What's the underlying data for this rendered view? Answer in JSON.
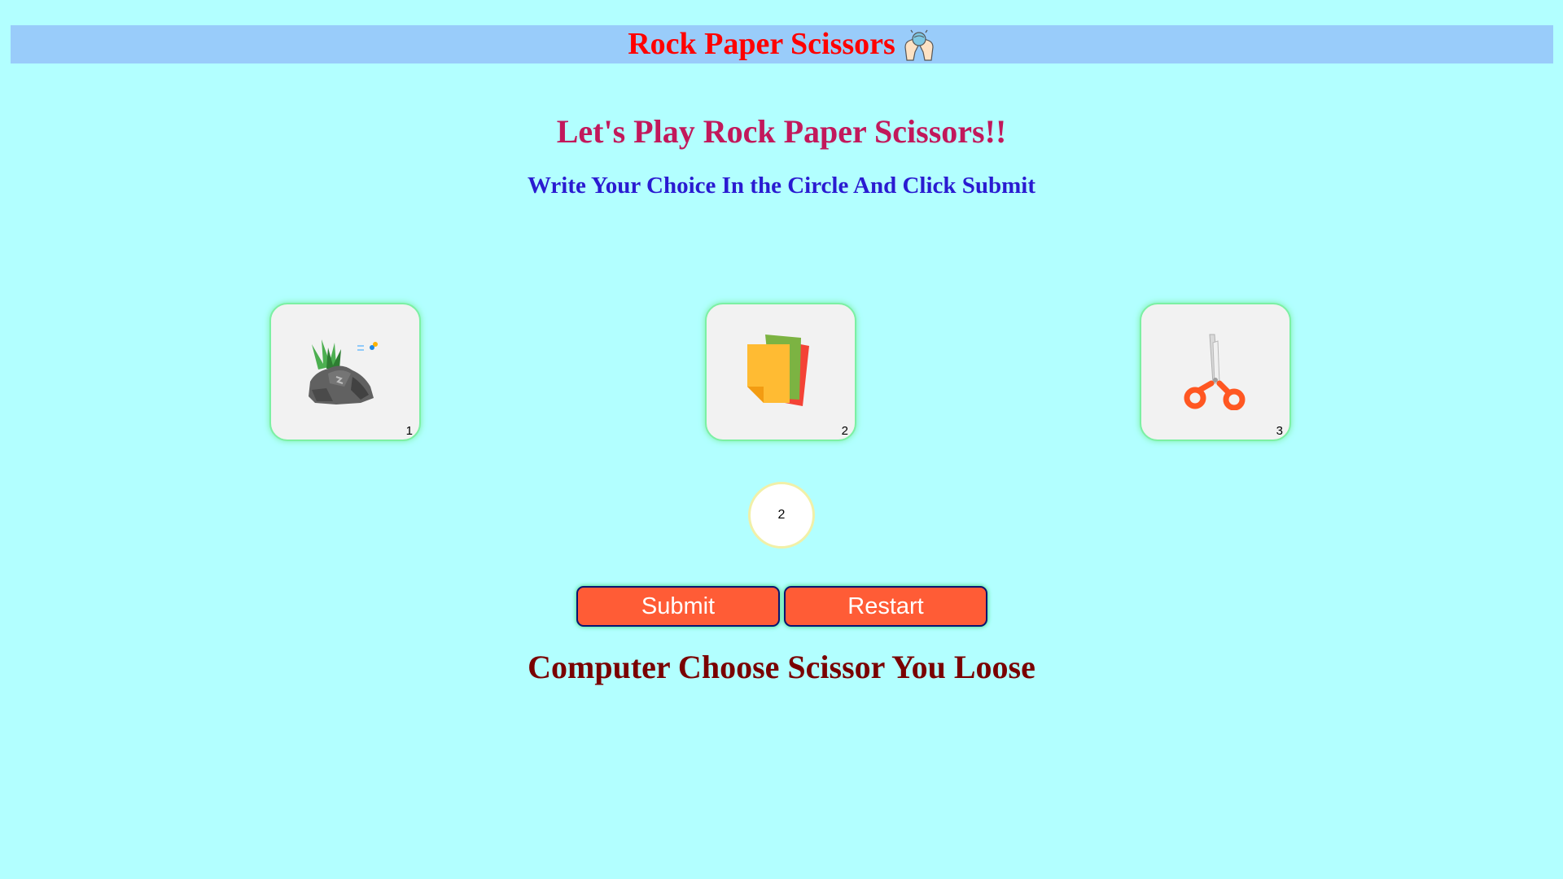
{
  "header": {
    "title": "Rock Paper Scissors",
    "icon": "rock-paper-scissors-hands-icon"
  },
  "main": {
    "heading": "Let's Play Rock Paper Scissors!!",
    "instruction": "Write Your Choice In the Circle And Click Submit"
  },
  "choices": [
    {
      "name": "Rock",
      "icon": "rock-icon",
      "number": "1"
    },
    {
      "name": "Paper",
      "icon": "paper-icon",
      "number": "2"
    },
    {
      "name": "Scissors",
      "icon": "scissors-icon",
      "number": "3"
    }
  ],
  "input": {
    "value": "2"
  },
  "buttons": {
    "submit_label": "Submit",
    "restart_label": "Restart"
  },
  "result": {
    "text": "Computer Choose Scissor You Loose"
  },
  "colors": {
    "background": "#b2ffff",
    "header_bar": "#99ccfa",
    "header_title": "#ff0000",
    "heading": "#c2185b",
    "instruction": "#2a1bd1",
    "button": "#ff5c36",
    "result": "#7a0000"
  }
}
